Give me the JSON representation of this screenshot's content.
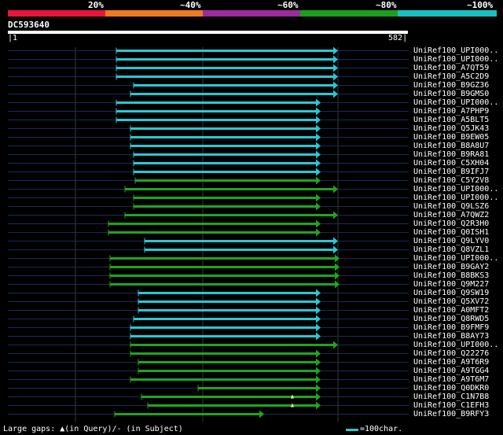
{
  "scale": {
    "labels": [
      "20%",
      "~40%",
      "~60%",
      "~80%",
      "~100%"
    ],
    "colors": [
      "#e8163a",
      "#f07a20",
      "#9c2c9c",
      "#1aa01a",
      "#1ac0c0"
    ]
  },
  "query": {
    "name": "DC593640",
    "start": "1",
    "end": "582"
  },
  "hits": [
    {
      "label": "UniRef100_UPI000..",
      "start": 148,
      "end": 424,
      "color": "cyan"
    },
    {
      "label": "UniRef100_UPI000..",
      "start": 148,
      "end": 424,
      "color": "cyan"
    },
    {
      "label": "UniRef100_A7QT59",
      "start": 148,
      "end": 424,
      "color": "cyan"
    },
    {
      "label": "UniRef100_A5C2D9",
      "start": 148,
      "end": 424,
      "color": "cyan"
    },
    {
      "label": "UniRef100_B9GZ36",
      "start": 170,
      "end": 424,
      "color": "cyan"
    },
    {
      "label": "UniRef100_B9GMS0",
      "start": 166,
      "end": 424,
      "color": "cyan"
    },
    {
      "label": "UniRef100_UPI000..",
      "start": 148,
      "end": 402,
      "color": "cyan"
    },
    {
      "label": "UniRef100_A7PHP9",
      "start": 148,
      "end": 402,
      "color": "cyan"
    },
    {
      "label": "UniRef100_A5BLT5",
      "start": 148,
      "end": 402,
      "color": "cyan"
    },
    {
      "label": "UniRef100_Q5JK43",
      "start": 166,
      "end": 402,
      "color": "cyan"
    },
    {
      "label": "UniRef100_B9EW05",
      "start": 166,
      "end": 402,
      "color": "cyan"
    },
    {
      "label": "UniRef100_B8A8U7",
      "start": 166,
      "end": 402,
      "color": "cyan"
    },
    {
      "label": "UniRef100_B9RA81",
      "start": 170,
      "end": 402,
      "color": "cyan"
    },
    {
      "label": "UniRef100_C5XH04",
      "start": 170,
      "end": 402,
      "color": "cyan"
    },
    {
      "label": "UniRef100_B9IFJ7",
      "start": 170,
      "end": 402,
      "color": "cyan"
    },
    {
      "label": "UniRef100_C5Y2V8",
      "start": 172,
      "end": 402,
      "color": "green"
    },
    {
      "label": "UniRef100_UPI000..",
      "start": 159,
      "end": 424,
      "color": "green"
    },
    {
      "label": "UniRef100_UPI000..",
      "start": 170,
      "end": 402,
      "color": "green"
    },
    {
      "label": "UniRef100_Q9LSZ6",
      "start": 170,
      "end": 402,
      "color": "green"
    },
    {
      "label": "UniRef100_A7QWZ2",
      "start": 159,
      "end": 424,
      "color": "green"
    },
    {
      "label": "UniRef100_Q2R3H0",
      "start": 138,
      "end": 402,
      "color": "green"
    },
    {
      "label": "UniRef100_Q0ISH1",
      "start": 138,
      "end": 402,
      "color": "green"
    },
    {
      "label": "UniRef100_Q9LYV0",
      "start": 184,
      "end": 424,
      "color": "cyan"
    },
    {
      "label": "UniRef100_Q8VZL1",
      "start": 184,
      "end": 424,
      "color": "cyan"
    },
    {
      "label": "UniRef100_UPI000..",
      "start": 140,
      "end": 426,
      "color": "green"
    },
    {
      "label": "UniRef100_B9GAY2",
      "start": 140,
      "end": 426,
      "color": "green"
    },
    {
      "label": "UniRef100_B8BKS3",
      "start": 140,
      "end": 426,
      "color": "green"
    },
    {
      "label": "UniRef100_Q9M227",
      "start": 140,
      "end": 426,
      "color": "green"
    },
    {
      "label": "UniRef100_Q9SW19",
      "start": 176,
      "end": 402,
      "color": "cyan"
    },
    {
      "label": "UniRef100_Q5XV72",
      "start": 176,
      "end": 402,
      "color": "cyan"
    },
    {
      "label": "UniRef100_A0MFT2",
      "start": 176,
      "end": 402,
      "color": "cyan"
    },
    {
      "label": "UniRef100_Q8RWD5",
      "start": 170,
      "end": 402,
      "color": "cyan"
    },
    {
      "label": "UniRef100_B9FMF9",
      "start": 166,
      "end": 402,
      "color": "cyan"
    },
    {
      "label": "UniRef100_B8AY73",
      "start": 166,
      "end": 402,
      "color": "cyan"
    },
    {
      "label": "UniRef100_UPI000..",
      "start": 166,
      "end": 424,
      "color": "green"
    },
    {
      "label": "UniRef100_Q22276",
      "start": 166,
      "end": 402,
      "color": "green"
    },
    {
      "label": "UniRef100_A9T6R9",
      "start": 176,
      "end": 402,
      "color": "green"
    },
    {
      "label": "UniRef100_A9TGG4",
      "start": 176,
      "end": 402,
      "color": "green"
    },
    {
      "label": "UniRef100_A9T6M7",
      "start": 166,
      "end": 402,
      "color": "green"
    },
    {
      "label": "UniRef100_Q0DKR0",
      "start": 252,
      "end": 402,
      "color": "green"
    },
    {
      "label": "UniRef100_C1N7B8",
      "start": 180,
      "end": 402,
      "color": "green",
      "gap": 370
    },
    {
      "label": "UniRef100_C1EFH3",
      "start": 188,
      "end": 402,
      "color": "green",
      "gap": 370
    },
    {
      "label": "UniRef100_B9RFY3",
      "start": 146,
      "end": 330,
      "color": "green"
    }
  ],
  "legend": {
    "gaps": "Large gaps: ▲(in Query)/- (in Subject)",
    "scale": "=100char."
  }
}
